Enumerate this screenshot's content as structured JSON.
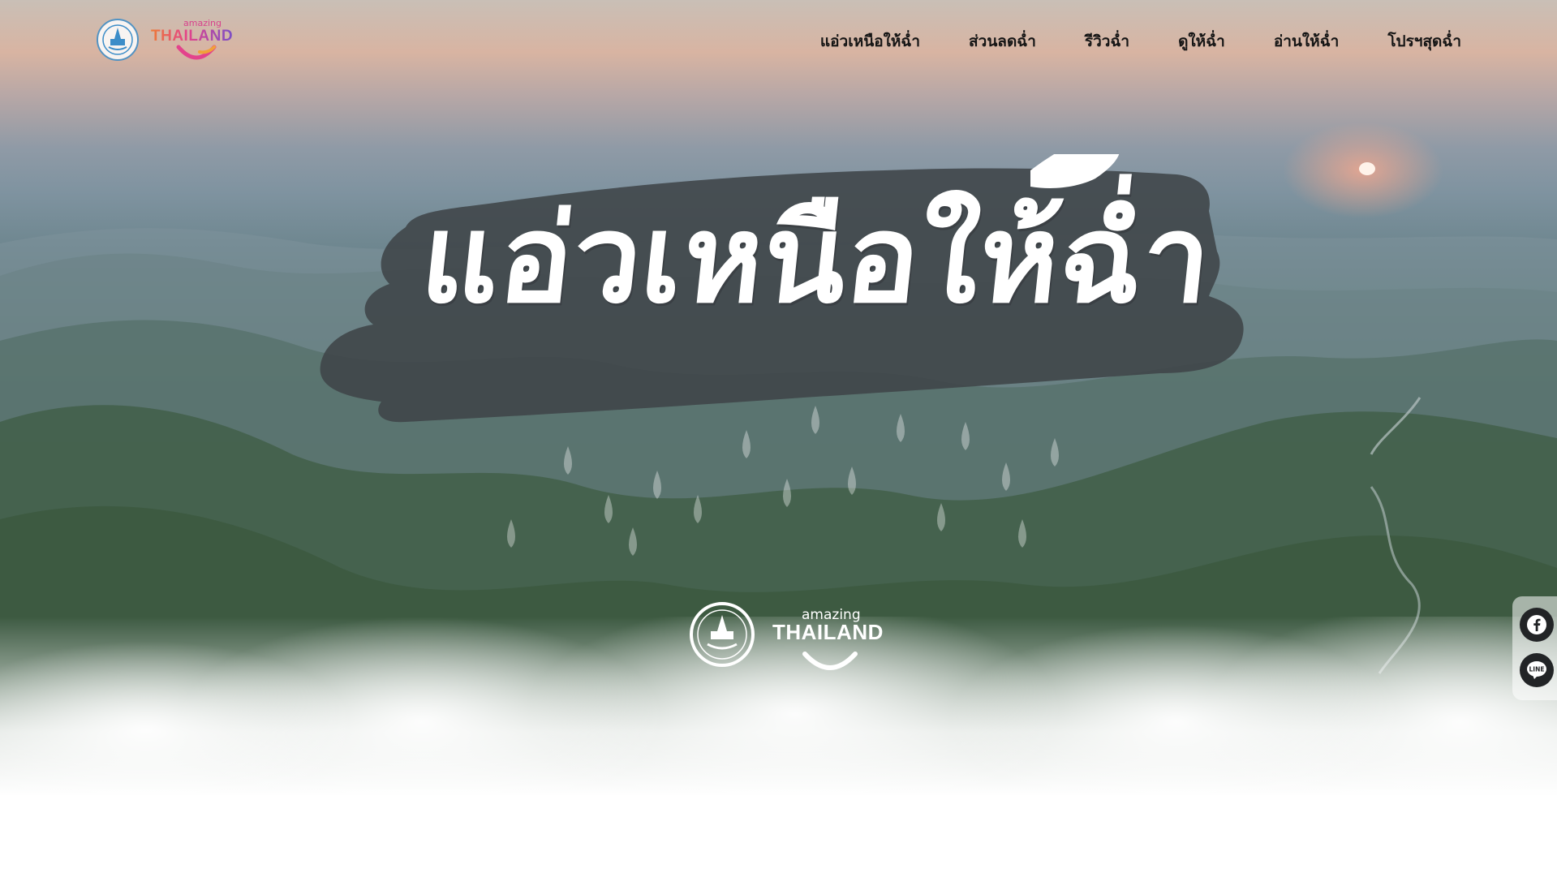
{
  "header": {
    "logos": {
      "tat_alt": "Tourism Authority of Thailand logo",
      "amazing_small": "amazing",
      "thailand": "THAILAND"
    },
    "nav": [
      {
        "label": "แอ่วเหนือให้ฉ่ำ"
      },
      {
        "label": "ส่วนลดฉ่ำ"
      },
      {
        "label": "รีวิวฉ่ำ"
      },
      {
        "label": "ดูให้ฉ่ำ"
      },
      {
        "label": "อ่านให้ฉ่ำ"
      },
      {
        "label": "โปรฯสุดฉ่ำ"
      }
    ]
  },
  "hero": {
    "title": "แอ่วเหนือให้ฉ่ำ",
    "center_logo": {
      "amazing": "amazing",
      "thailand": "THAILAND"
    }
  },
  "social": {
    "items": [
      {
        "name": "facebook-icon"
      },
      {
        "name": "line-icon",
        "label": "LINE"
      }
    ]
  },
  "colors": {
    "nav_text": "#151515",
    "banner_brush": "#3f4448",
    "accent_pink": "#e3438c",
    "accent_orange": "#ee7a36",
    "accent_purple": "#7b4fc6"
  }
}
